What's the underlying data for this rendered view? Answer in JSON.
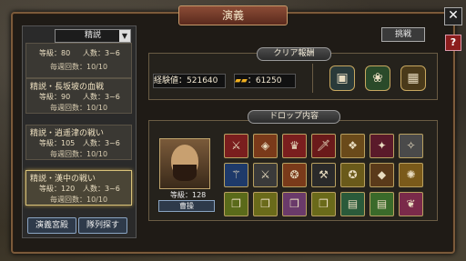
{
  "window": {
    "title": "演義",
    "close_label": "✕",
    "help_label": "?"
  },
  "left_panel": {
    "dropdown": {
      "value": "精説",
      "arrow": "▼"
    },
    "cards": [
      {
        "name": "",
        "level": "等級：80",
        "players": "人数：3~6",
        "weekly": "毎週回数：10/10",
        "selected": false
      },
      {
        "name": "精説・長坂坡の血戦",
        "level": "等級：90",
        "players": "人数：3~6",
        "weekly": "毎週回数：10/10",
        "selected": false
      },
      {
        "name": "精説・逍遥津の戦い",
        "level": "等級：105",
        "players": "人数：3~6",
        "weekly": "毎週回数：10/10",
        "selected": false
      },
      {
        "name": "精説・漢中の戦い",
        "level": "等級：120",
        "players": "人数：3~6",
        "weekly": "毎週回数：10/10",
        "selected": true
      }
    ],
    "buttons": {
      "palace": "演義宮殿",
      "find_team": "隊列探す"
    }
  },
  "right_panel": {
    "challenge_label": "挑戦",
    "clear_reward": {
      "title": "クリア報酬",
      "exp_label": "経験値：",
      "exp_value": "521640",
      "gold_icon": "gold-ingots-icon",
      "gold_value": "：61250",
      "reward_icons": [
        "chest-icon",
        "jade-bag-icon",
        "treasure-chest-icon"
      ]
    },
    "drop": {
      "title": "ドロップ内容",
      "hero_level": "等級：128",
      "hero_button": "曹操",
      "items": [
        {
          "icon": "spear-icon",
          "color": "#7a1e1e",
          "glyph": "⚔"
        },
        {
          "icon": "armor-icon",
          "color": "#7a3a1a",
          "glyph": "◈"
        },
        {
          "icon": "helmet-icon",
          "color": "#7a1e1e",
          "glyph": "♛"
        },
        {
          "icon": "sword-icon",
          "color": "#6a1a1a",
          "glyph": "🗡"
        },
        {
          "icon": "boots-icon",
          "color": "#6a4a1a",
          "glyph": "❖"
        },
        {
          "icon": "robe-icon",
          "color": "#5a1a2a",
          "glyph": "✦"
        },
        {
          "icon": "gauntlet-icon",
          "color": "#4a4a4a",
          "glyph": "✧"
        },
        {
          "icon": "blue-weapon-icon",
          "color": "#1e3a6a",
          "glyph": "⚚"
        },
        {
          "icon": "blade-icon",
          "color": "#3a3a3a",
          "glyph": "⚔"
        },
        {
          "icon": "cloak-icon",
          "color": "#7a3a1a",
          "glyph": "❂"
        },
        {
          "icon": "halberd-icon",
          "color": "#2a2a2a",
          "glyph": "⚒"
        },
        {
          "icon": "medal-icon",
          "color": "#6a5a1a",
          "glyph": "✪"
        },
        {
          "icon": "greaves-icon",
          "color": "#5a3a1a",
          "glyph": "◆"
        },
        {
          "icon": "fan-icon",
          "color": "#7a5a1a",
          "glyph": "✺"
        },
        {
          "icon": "scroll-icon",
          "color": "#5a6a1a",
          "glyph": "❒"
        },
        {
          "icon": "scroll-icon",
          "color": "#6a6a1a",
          "glyph": "❒"
        },
        {
          "icon": "scroll-icon",
          "color": "#6a3a6a",
          "glyph": "❒"
        },
        {
          "icon": "scroll-icon",
          "color": "#6a6a1a",
          "glyph": "❒"
        },
        {
          "icon": "book-icon",
          "color": "#2a5a3a",
          "glyph": "▤"
        },
        {
          "icon": "book-icon",
          "color": "#3a6a2a",
          "glyph": "▤"
        },
        {
          "icon": "pink-scroll-icon",
          "color": "#7a2a4a",
          "glyph": "❦"
        }
      ]
    }
  }
}
